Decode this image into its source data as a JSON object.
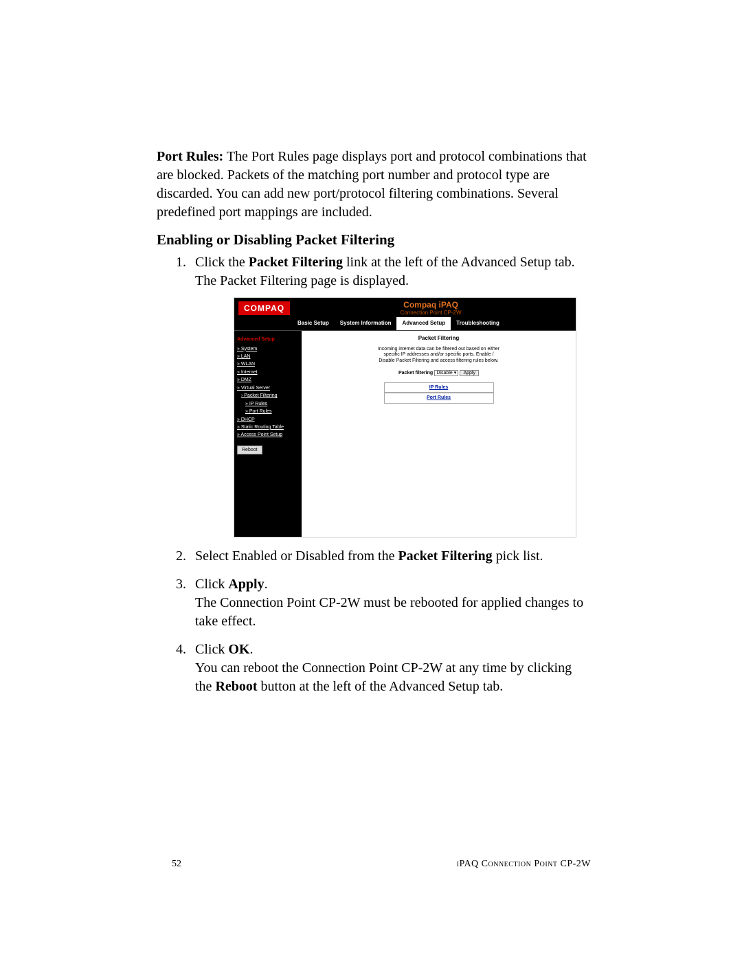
{
  "intro": {
    "port_rules_label": "Port Rules:",
    "port_rules_text": " The Port Rules page displays port and protocol combinations that are blocked. Packets of the matching port number and protocol type are discarded. You can add new port/protocol filtering combinations. Several predefined port mappings are included."
  },
  "section_heading": "Enabling or Disabling Packet Filtering",
  "steps": {
    "s1_num": "1.",
    "s1_a": "Click the ",
    "s1_b": "Packet Filtering",
    "s1_c": " link at the left of the Advanced Setup tab.",
    "s1_d": "The Packet Filtering page is displayed.",
    "s2_num": "2.",
    "s2_a": "Select Enabled or Disabled from the ",
    "s2_b": "Packet Filtering",
    "s2_c": " pick list.",
    "s3_num": "3.",
    "s3_a": "Click ",
    "s3_b": "Apply",
    "s3_c": ".",
    "s3_d": "The Connection Point CP-2W must be rebooted for applied changes to take effect.",
    "s4_num": "4.",
    "s4_a": "Click ",
    "s4_b": "OK",
    "s4_c": ".",
    "s4_d1": "You can reboot the Connection Point CP-2W at any time by clicking the ",
    "s4_d2": "Reboot",
    "s4_d3": " button at the left of the Advanced Setup tab."
  },
  "embed": {
    "logo": "COMPAQ",
    "title_main": "Compaq iPAQ",
    "title_sub": "Connection Point CP-2W",
    "tabs": {
      "basic": "Basic Setup",
      "sysinfo": "System Information",
      "advanced": "Advanced Setup",
      "trouble": "Troubleshooting"
    },
    "sidebar": {
      "heading": "Advanced Setup",
      "system": "» System",
      "lan": "» LAN",
      "wlan": "» WLAN",
      "internet": "» Internet",
      "dmz": "» DMZ",
      "vserver": "» Virtual Server",
      "pfilter": "› Packet Filtering",
      "iprules": "» IP Rules",
      "portrules": "» Port Rules",
      "dhcp": "» DHCP",
      "srt": "» Static Routing Table",
      "aps": "» Access Point Setup",
      "reboot": "Reboot"
    },
    "content": {
      "title": "Packet Filtering",
      "desc": "Incoming internet data can be filtered out based on either specific IP addresses and/or specific ports. Enable / Disable Packet Filtering and access filtering rules below.",
      "filter_label": "Packet filtering",
      "select_value": "Disable",
      "apply": "Apply",
      "ip_rules": "IP Rules",
      "port_rules": "Port Rules"
    }
  },
  "footer": {
    "page": "52",
    "title": "iPAQ Connection Point CP-2W"
  }
}
